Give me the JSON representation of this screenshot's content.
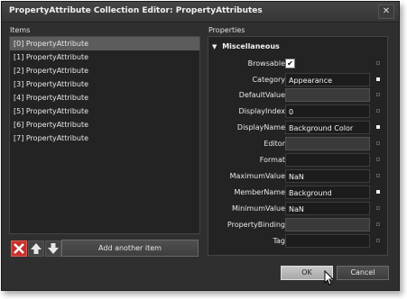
{
  "window": {
    "title": "PropertyAttribute Collection Editor: PropertyAttributes",
    "close_glyph": "✕"
  },
  "items_panel": {
    "label": "Items",
    "items": [
      "[0] PropertyAttribute",
      "[1] PropertyAttribute",
      "[2] PropertyAttribute",
      "[3] PropertyAttribute",
      "[4] PropertyAttribute",
      "[5] PropertyAttribute",
      "[6] PropertyAttribute",
      "[7] PropertyAttribute"
    ],
    "selected_index": 0,
    "remove_icon": "delete-x-icon",
    "move_up_icon": "arrow-up-icon",
    "move_down_icon": "arrow-down-icon",
    "add_label": "Add another item"
  },
  "properties_panel": {
    "label": "Properties",
    "category": "Miscellaneous",
    "properties": [
      {
        "name": "Browsable",
        "type": "checkbox",
        "checked": true,
        "check_glyph": "✔"
      },
      {
        "name": "Category",
        "type": "text",
        "value": "Appearance",
        "set": true
      },
      {
        "name": "DefaultValue",
        "type": "text",
        "value": "",
        "set": false
      },
      {
        "name": "DisplayIndex",
        "type": "text",
        "value": "0",
        "set": true
      },
      {
        "name": "DisplayName",
        "type": "text",
        "value": "Background Color",
        "set": true
      },
      {
        "name": "Editor",
        "type": "text",
        "value": "",
        "set": false
      },
      {
        "name": "Format",
        "type": "text",
        "value": "",
        "set": true
      },
      {
        "name": "MaximumValue",
        "type": "text",
        "value": "NaN",
        "set": true
      },
      {
        "name": "MemberName",
        "type": "text",
        "value": "Background",
        "set": true
      },
      {
        "name": "MinimumValue",
        "type": "text",
        "value": "NaN",
        "set": true
      },
      {
        "name": "PropertyBinding",
        "type": "text",
        "value": "",
        "set": false
      },
      {
        "name": "Tag",
        "type": "text",
        "value": "",
        "set": true
      }
    ]
  },
  "footer": {
    "ok_label": "OK",
    "cancel_label": "Cancel"
  },
  "colors": {
    "window_bg": "#2f2f2f",
    "panel_bg": "#232323",
    "selected_bg": "#5c5c5c",
    "remove_red": "#c8312b"
  }
}
